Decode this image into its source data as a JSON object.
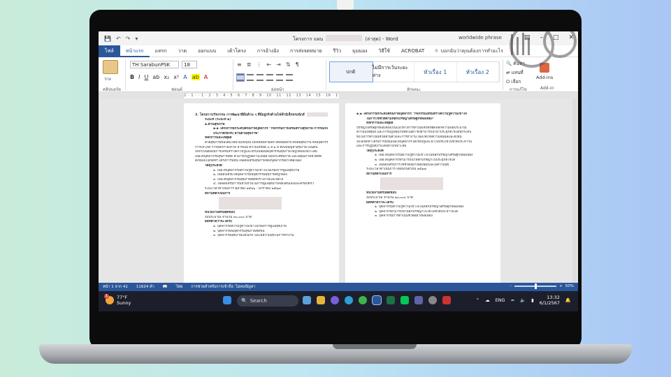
{
  "titlebar": {
    "doc_name": "โครงการ แผน",
    "doc_suffix": "(ล่าสุด) - Word",
    "right_text": "worldwide phrase"
  },
  "ribbon_tabs": [
    "ไฟล์",
    "หน้าแรก",
    "แทรก",
    "วาด",
    "ออกแบบ",
    "เค้าโครง",
    "การอ้างอิง",
    "การส่งจดหมาย",
    "รีวิว",
    "มุมมอง",
    "วิธีใช้",
    "ACROBAT"
  ],
  "tell_me": "บอกฉันว่าคุณต้องการทำอะไร",
  "home": {
    "paste_label": "วาง",
    "font_name": "TH SarabunPSK",
    "font_size": "18",
    "styles": [
      "ปกติ",
      "ไม่มีการเว้นระยะห่าง",
      "หัวเรื่อง 1",
      "หัวเรื่อง 2"
    ],
    "editing": [
      "ค้นหา",
      "แทนที่",
      "เลือก"
    ],
    "addins": "Add-ins",
    "group_labels": [
      "คลิปบอร์ด",
      "ฟอนต์",
      "ย่อหน้า",
      "ลักษณะ",
      "การแก้ไข",
      "Add-in"
    ]
  },
  "ruler_text": "2 · 1 · · 1 · 2 · 3 · 4 · 5 · 6 · 7 · 8 · 9 · 10 · 11 · 12 · 13 · 14 · 15 · 16 · 17 · 18 · 19",
  "left_page": [
    {
      "t": "3. โครงการ/กิจกรรม การพัฒนาฝีมือด้าน ๆ ที่มีอยู่จริงด้านไฟฟ้าอิเล็กทรอนิกส์",
      "c": "bold",
      "r": true
    },
    {
      "t": "ระยะที่ (ระยะที่ ๑)",
      "c": "bold ind"
    },
    {
      "t": "๑.ด้านสุขภาพ",
      "c": "bold ind"
    },
    {
      "t": "๑.๑ โครงการยกระดับศักยภาพบุคลากร \"กิจกรรมการเสริมสร้างสุขภาพ การรณรงค์",
      "c": "bold ind2"
    },
    {
      "t": "ประกาศเชิงรับ ด้านตามสุขภาพ\"",
      "c": "bold ind2"
    },
    {
      "t": "หลักการและเหตุผล",
      "c": "bold ind"
    },
    {
      "t": "ด้วยสุขภาพของคนไทยในปัจจุบัน มีปัจจัยหลายอย่างที่ส่งผลกระทบต่อสุขภาพ ทั้งพฤติกรรม",
      "c": "ind"
    },
    {
      "t": "การบริโภค การออกกำลังกาย อารมณ์ ความเครียด ๓ อ ๒ ส ที่เป็นปัญหาสุขภาพ เป็นต้น",
      "c": ""
    },
    {
      "t": "จึงจำเป็นต้องมีการเสริมสร้างความรู้และปรับเปลี่ยนพฤติกรรมสุขภาพให้ถูกต้องเหมาะสม",
      "c": ""
    },
    {
      "t": "เพื่อให้บุคลากรมีสุขภาพที่ดี สามารถปฏิบัติงานได้อย่างมีประสิทธิภาพ และมีคุณภาพชีวิตที่ดี",
      "c": ""
    },
    {
      "t": "ดังนั้นจึงได้จัดทำโครงการนี้ขึ้น เพื่อส่งเสริมสุขภาพของบุคลากรอย่างต่อเนื่อง",
      "c": ""
    },
    {
      "t": "วัตถุประสงค์",
      "c": "bold ind"
    },
    {
      "t": "๑. เพื่อให้บุคลากรมีความรู้ความเข้าใจในเรื่องการดูแลสุขภาพ",
      "c": "ind2"
    },
    {
      "t": "๒. เพื่อส่งเสริมให้บุคลากรมีพฤติกรรมสุขภาพที่ถูกต้อง",
      "c": "ind2"
    },
    {
      "t": "๓. เพื่อให้บุคลากรมีสุขภาพที่ดีทั้งร่างกายและจิตใจ",
      "c": "ind2"
    },
    {
      "t": "๔. เพื่อส่งเสริมการมีส่วนร่วมในการดูแลสุขภาพของตนเองและครอบครัว",
      "c": "ind2"
    },
    {
      "t": "ระยะเวลาดำเนินการ       ตุลาคม ๒๕๖๖ - มกราคม ๒๕๖๗",
      "c": "ind"
    },
    {
      "t": "สถานที่ดำเนินการ",
      "c": "bold ind",
      "rb": true
    },
    {
      "t": "หน่วยงานที่รับผิดชอบ",
      "c": "bold ind"
    },
    {
      "t": "งบประมาณ          จำนวน ๓๐,๐๐๐ บาท",
      "c": "ind"
    },
    {
      "t": "ผลที่คาดว่าจะได้รับ",
      "c": "bold ind"
    },
    {
      "t": "๑. บุคลากรมีความรู้ความเข้าใจเรื่องการดูแลสุขภาพ",
      "c": "ind2"
    },
    {
      "t": "๒. บุคลากรมีพฤติกรรมสุขภาพที่ดีขึ้น",
      "c": "ind2"
    },
    {
      "t": "๓. บุคลากรมีสุขภาพแข็งแรง และมีความสุขในการทำงาน",
      "c": "ind2"
    }
  ],
  "right_page": [
    {
      "t": "๑.๒ โครงการยกระดับศักยภาพบุคลากร \"กิจกรรมเสริมสร้างความรู้ความเข้าใจ",
      "c": "bold"
    },
    {
      "t": "ในการใช้ชีวิตตามหลักปรัชญาเศรษฐกิจพอเพียง\"",
      "c": "bold ind"
    },
    {
      "t": "หลักการและเหตุผล",
      "c": "bold ind"
    },
    {
      "t": "ปรัชญาเศรษฐกิจพอเพียงเป็นแนวทางการดำเนินชีวิตที่ยึดหลักความพอประมาณ",
      "c": ""
    },
    {
      "t": "ความมีเหตุผล และการมีภูมิคุ้มกันที่ดีในตัว ซึ่งสามารถนำมาประยุกต์ใช้ได้ทุกระดับ",
      "c": ""
    },
    {
      "t": "ทั้งในการดำเนินชีวิตส่วนตัวและการทำงาน เพื่อให้เกิดความสมดุลและยั่งยืน",
      "c": ""
    },
    {
      "t": "จึงได้จัดทำโครงการนี้ขึ้นเพื่อให้บุคลากรได้เรียนรู้และนำไปปรับใช้ในชีวิตประจำวัน",
      "c": ""
    },
    {
      "t": "และการปฏิบัติงานได้อย่างเหมาะสม",
      "c": ""
    },
    {
      "t": "วัตถุประสงค์",
      "c": "bold ind"
    },
    {
      "t": "๑. เพื่อให้บุคลากรมีความรู้ความเข้าใจในหลักปรัชญาเศรษฐกิจพอเพียง",
      "c": "ind2"
    },
    {
      "t": "๒. เพื่อให้บุคลากรสามารถนำหลักปรัชญาไปประยุกต์ใช้ได้",
      "c": "ind2"
    },
    {
      "t": "๓. เพื่อส่งเสริมการใช้ชีวิตอย่างพอเพียงและมีความสุข",
      "c": "ind2"
    },
    {
      "t": "ระยะเวลาดำเนินการ       เดือนกันยายน ๒๕๖๗",
      "c": "ind"
    },
    {
      "t": "สถานที่ดำเนินการ",
      "c": "bold ind",
      "rb": true
    },
    {
      "t": "หน่วยงานที่รับผิดชอบ",
      "c": "bold ind"
    },
    {
      "t": "งบประมาณ          จำนวน ๒๐,๐๐๐ บาท",
      "c": "ind"
    },
    {
      "t": "ผลที่คาดว่าจะได้รับ",
      "c": "bold ind"
    },
    {
      "t": "๑. บุคลากรมีความรู้ความเข้าใจในหลักปรัชญาเศรษฐกิจพอเพียง",
      "c": "ind2"
    },
    {
      "t": "๒. บุคลากรสามารถนำหลักปรัชญาไปใช้ในชีวิตประจำวันได้",
      "c": "ind2"
    },
    {
      "t": "๓. บุคลากรมีการดำเนินชีวิตอย่างพอเพียง",
      "c": "ind2"
    }
  ],
  "status": {
    "page": "หน้า 1 จาก 41",
    "words": "11624 คำ",
    "language": "ไทย",
    "accessibility": "การช่วยสำหรับการเข้าถึง: ไม่พบปัญหา",
    "zoom": "50%",
    "zoom_fraction": 0.5
  },
  "taskbar": {
    "temp": "77°F",
    "weather": "Sunny",
    "badge": "1",
    "search": "Search",
    "lang": "ENG",
    "time": "13:32",
    "date": "6/1/2567"
  },
  "colors": {
    "word_blue": "#2b579a",
    "taskbar": "#1c1f2b"
  }
}
